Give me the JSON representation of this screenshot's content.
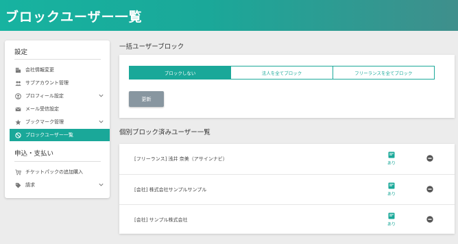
{
  "header": {
    "title": "ブロックユーザー一覧"
  },
  "sidebar": {
    "settings_title": "設定",
    "items": [
      {
        "label": "会社情報変更",
        "icon": "building-icon",
        "has_chevron": false
      },
      {
        "label": "サブアカウント管理",
        "icon": "people-icon",
        "has_chevron": false
      },
      {
        "label": "プロフィール設定",
        "icon": "account-circle-icon",
        "has_chevron": true
      },
      {
        "label": "メール受信設定",
        "icon": "mail-icon",
        "has_chevron": false
      },
      {
        "label": "ブックマーク管理",
        "icon": "star-icon",
        "has_chevron": true
      },
      {
        "label": "ブロックユーザー一覧",
        "icon": "block-icon",
        "has_chevron": false,
        "active": true
      }
    ],
    "billing_title": "申込・支払い",
    "billing_items": [
      {
        "label": "チケットパックの追加購入",
        "icon": "cart-icon",
        "has_chevron": false
      },
      {
        "label": "請求",
        "icon": "tag-icon",
        "has_chevron": true
      }
    ]
  },
  "bulk": {
    "heading": "一括ユーザーブロック",
    "options": [
      "ブロックしない",
      "法人を全てブロック",
      "フリーランスを全てブロック"
    ],
    "selected_index": 0,
    "update_label": "更新"
  },
  "individual": {
    "heading": "個別ブロック済みユーザー一覧",
    "memo_label": "あり",
    "rows": [
      {
        "name": "[フリーランス] 浅井 奈美（アサインナビ）"
      },
      {
        "name": "[会社] 株式会社サンプルサンプル"
      },
      {
        "name": "[会社] サンプル株式会社"
      }
    ]
  },
  "colors": {
    "accent": "#1aa899",
    "button_gray": "#8896a0",
    "remove_icon": "#555555"
  }
}
